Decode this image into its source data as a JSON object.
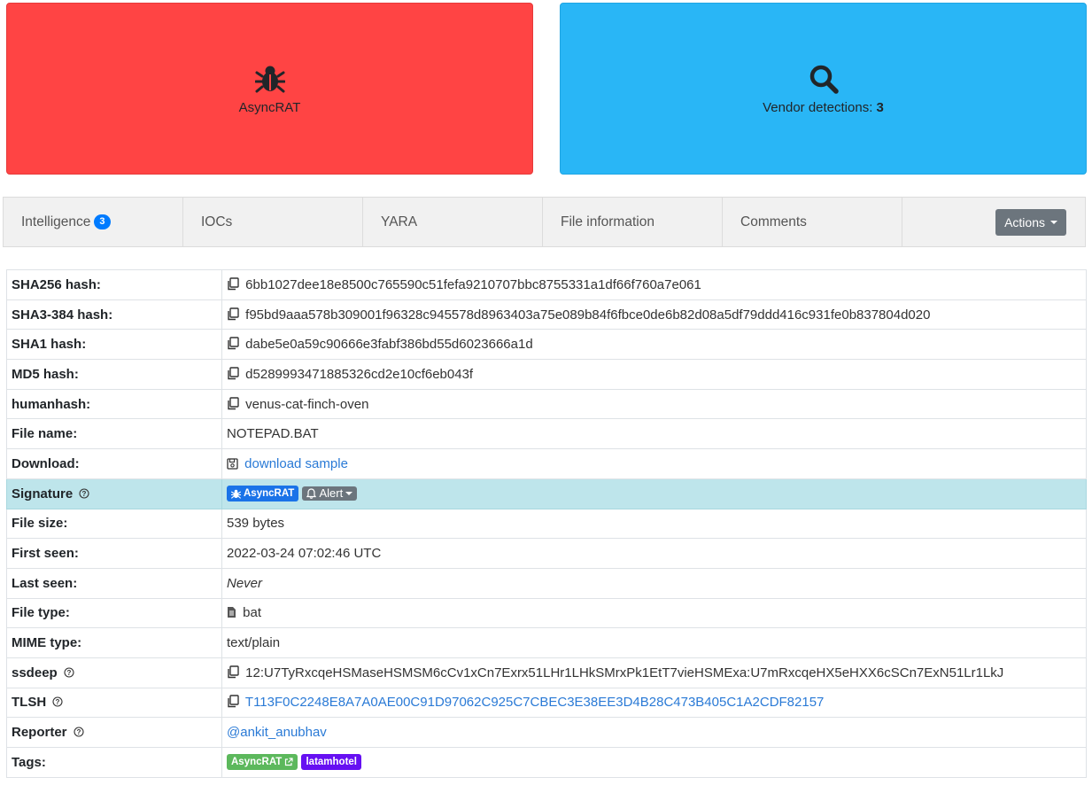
{
  "cards": {
    "family": "AsyncRAT",
    "detections_label": "Vendor detections:",
    "detections_count": "3",
    "colors": {
      "family_bg": "#ff4444",
      "detections_bg": "#29b6f6"
    },
    "icons": [
      "bug-icon",
      "search-icon"
    ]
  },
  "tabs": [
    {
      "label": "Intelligence",
      "badge": "3"
    },
    {
      "label": "IOCs"
    },
    {
      "label": "YARA"
    },
    {
      "label": "File information"
    },
    {
      "label": "Comments"
    }
  ],
  "actions_label": "Actions",
  "rows": {
    "sha256": {
      "key": "SHA256 hash:",
      "value": "6bb1027dee18e8500c765590c51fefa9210707bbc8755331a1df66f760a7e061"
    },
    "sha3": {
      "key": "SHA3-384 hash:",
      "value": "f95bd9aaa578b309001f96328c945578d8963403a75e089b84f6fbce0de6b82d08a5df79ddd416c931fe0b837804d020"
    },
    "sha1": {
      "key": "SHA1 hash:",
      "value": "dabe5e0a59c90666e3fabf386bd55d6023666a1d"
    },
    "md5": {
      "key": "MD5 hash:",
      "value": "d5289993471885326cd2e10cf6eb043f"
    },
    "humanhash": {
      "key": "humanhash:",
      "value": "venus-cat-finch-oven"
    },
    "filename": {
      "key": "File name:",
      "value": "NOTEPAD.BAT"
    },
    "download": {
      "key": "Download:",
      "value": "download sample"
    },
    "signature": {
      "key": "Signature",
      "tag": "AsyncRAT",
      "alert": "Alert"
    },
    "filesize": {
      "key": "File size:",
      "value": "539 bytes"
    },
    "firstseen": {
      "key": "First seen:",
      "value": "2022-03-24 07:02:46 UTC"
    },
    "lastseen": {
      "key": "Last seen:",
      "value": "Never"
    },
    "filetype": {
      "key": "File type:",
      "value": "bat"
    },
    "mime": {
      "key": "MIME type:",
      "value": "text/plain"
    },
    "ssdeep": {
      "key": "ssdeep",
      "value": "12:U7TyRxcqeHSMaseHSMSM6cCv1xCn7Exrx51LHr1LHkSMrxPk1EtT7vieHSMExa:U7mRxcqeHX5eHXX6cSCn7ExN51Lr1LkJ"
    },
    "tlsh": {
      "key": "TLSH",
      "value": "T113F0C2248E8A7A0AE00C91D97062C925C7CBEC3E38EE3D4B28C473B405C1A2CDF82157"
    },
    "reporter": {
      "key": "Reporter",
      "value": "@ankit_anubhav"
    },
    "tags": {
      "key": "Tags:",
      "items": [
        "AsyncRAT",
        "latamhotel"
      ]
    }
  }
}
